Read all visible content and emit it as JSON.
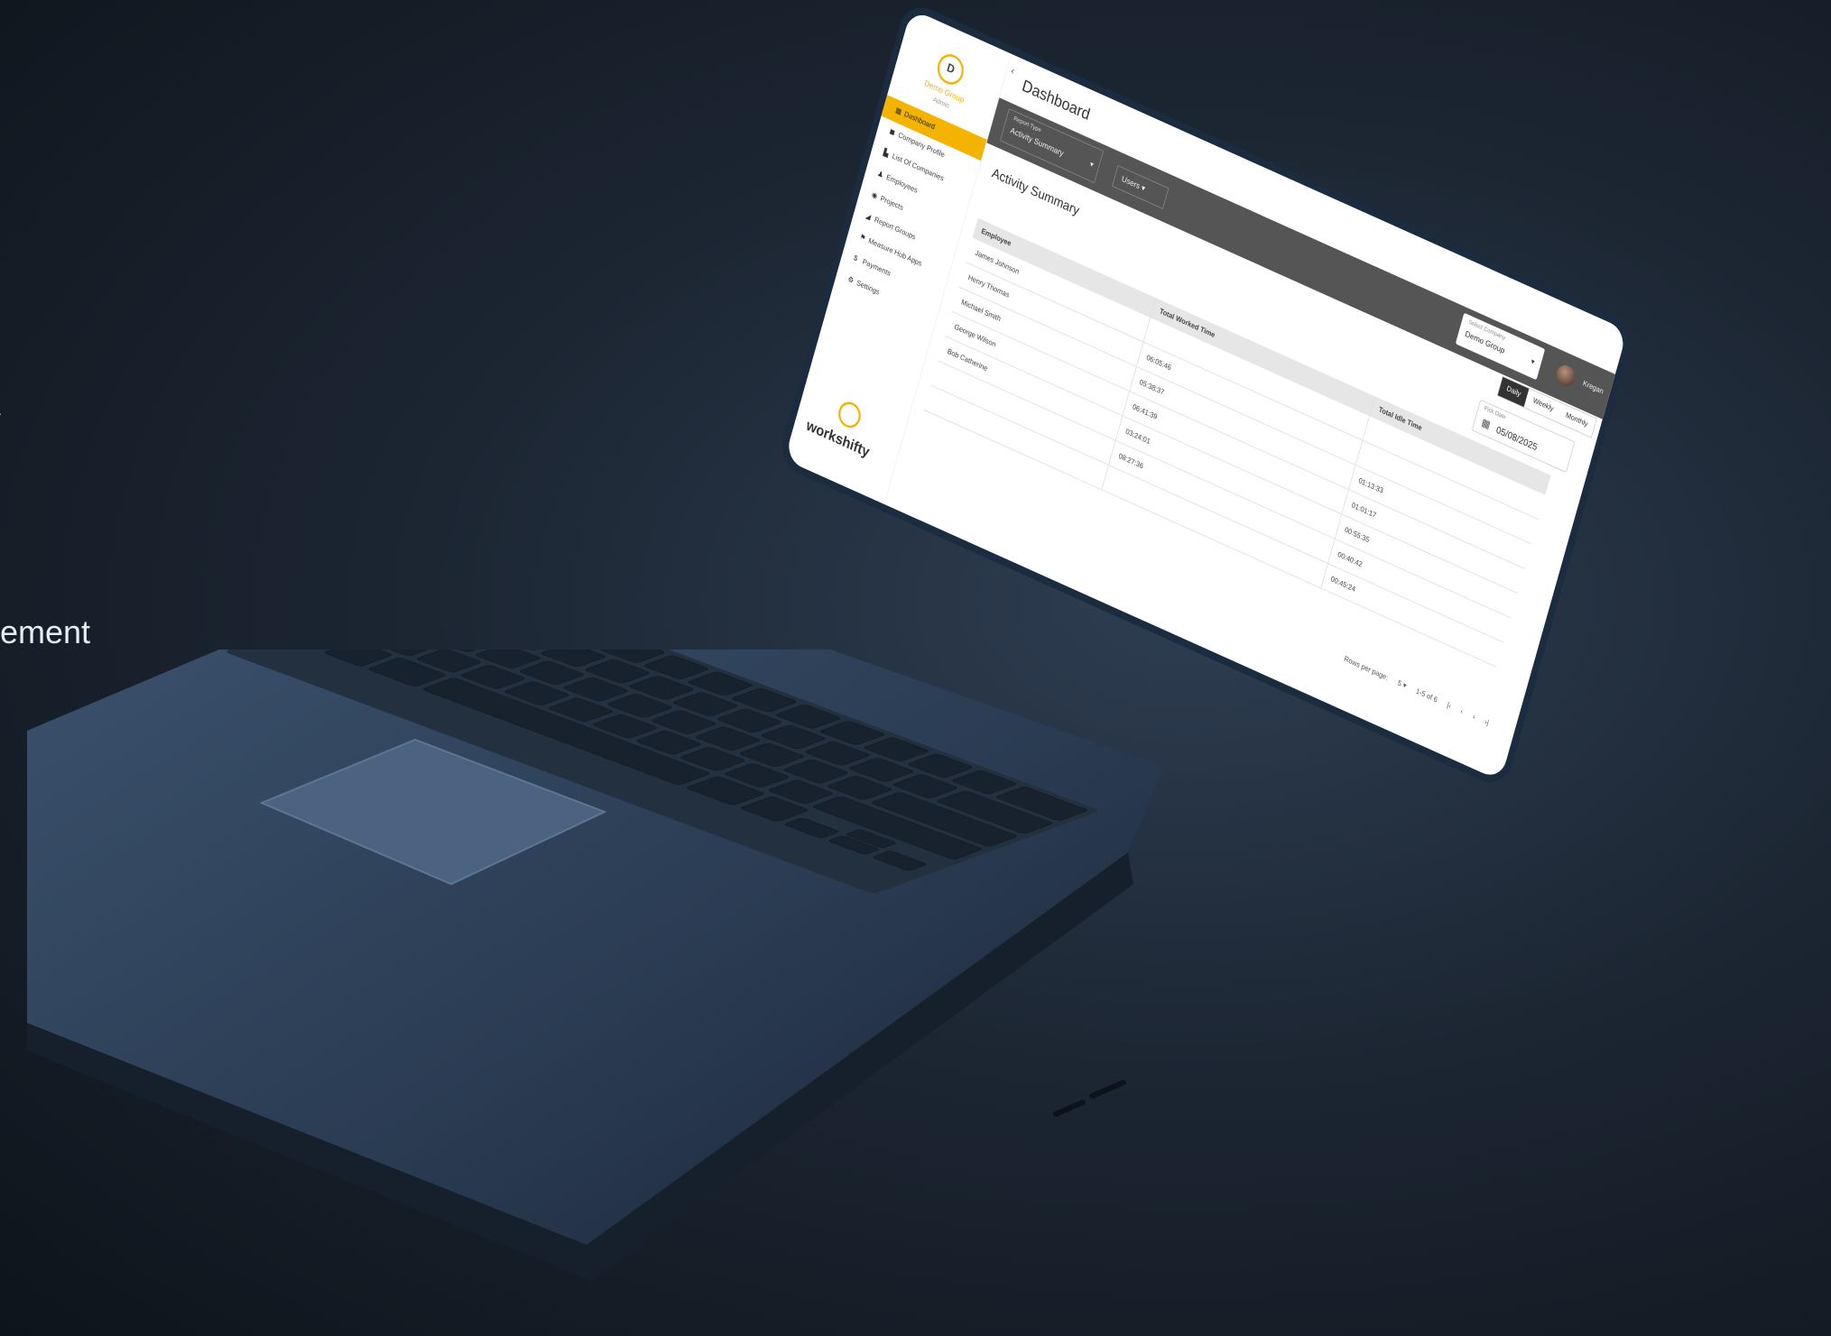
{
  "hero": {
    "heading_glyph": "/",
    "subtitle_fragment": "ement"
  },
  "app": {
    "company_name": "Demo Group",
    "company_sub": "Admin",
    "brand": "workshifty",
    "nav": [
      {
        "icon": "dashboard-icon",
        "glyph": "▦",
        "label": "Dashboard",
        "active": true
      },
      {
        "icon": "company-icon",
        "glyph": "◼",
        "label": "Company Profile",
        "active": false
      },
      {
        "icon": "companies-icon",
        "glyph": "▙",
        "label": "List Of Companies",
        "active": false
      },
      {
        "icon": "employees-icon",
        "glyph": "♟",
        "label": "Employees",
        "active": false
      },
      {
        "icon": "projects-icon",
        "glyph": "◉",
        "label": "Projects",
        "active": false
      },
      {
        "icon": "report-groups-icon",
        "glyph": "◢",
        "label": "Report Groups",
        "active": false
      },
      {
        "icon": "reports-icon",
        "glyph": "⚑",
        "label": "Measure Hub Apps",
        "active": false
      },
      {
        "icon": "payments-icon",
        "glyph": "$",
        "label": "Payments",
        "active": false
      },
      {
        "icon": "settings-icon",
        "glyph": "⚙",
        "label": "Settings",
        "active": false
      }
    ],
    "page_title": "Dashboard",
    "collapse_glyph": "‹",
    "filters": {
      "report_type_label": "Report Type",
      "report_type_value": "Activity Summary",
      "users_label": "Users",
      "company_label": "Select Company",
      "company_value": "Demo Group",
      "caret": "▾"
    },
    "user": {
      "name": "Kregan"
    },
    "period": [
      "Daily",
      "Weekly",
      "Monthly"
    ],
    "date": {
      "label": "Pick Date",
      "value": "05/08/2025",
      "icon": "calendar-icon",
      "glyph": "▦"
    },
    "section_title": "Activity Summary",
    "table": {
      "headers": [
        "Employee",
        "Total Worked Time",
        "Total Idle Time"
      ],
      "rows": [
        [
          "James Johnson",
          "",
          ""
        ],
        [
          "Henry Thomas",
          "06:05:46",
          ""
        ],
        [
          "Michael Smith",
          "05:38:37",
          "01:13:33"
        ],
        [
          "George Wilson",
          "06:41:39",
          "01:01:17"
        ],
        [
          "Bob Catherine",
          "03:24:01",
          "00:55:35"
        ],
        [
          "",
          "08:27:36",
          "00:40:42"
        ],
        [
          "",
          "",
          "00:45:24"
        ]
      ]
    },
    "pager": {
      "rows_label": "Rows per page:",
      "rows_value": "5 ▾",
      "range": "1-5 of 6",
      "first": "|‹",
      "prev": "‹",
      "next": "›",
      "last": "›|"
    }
  }
}
